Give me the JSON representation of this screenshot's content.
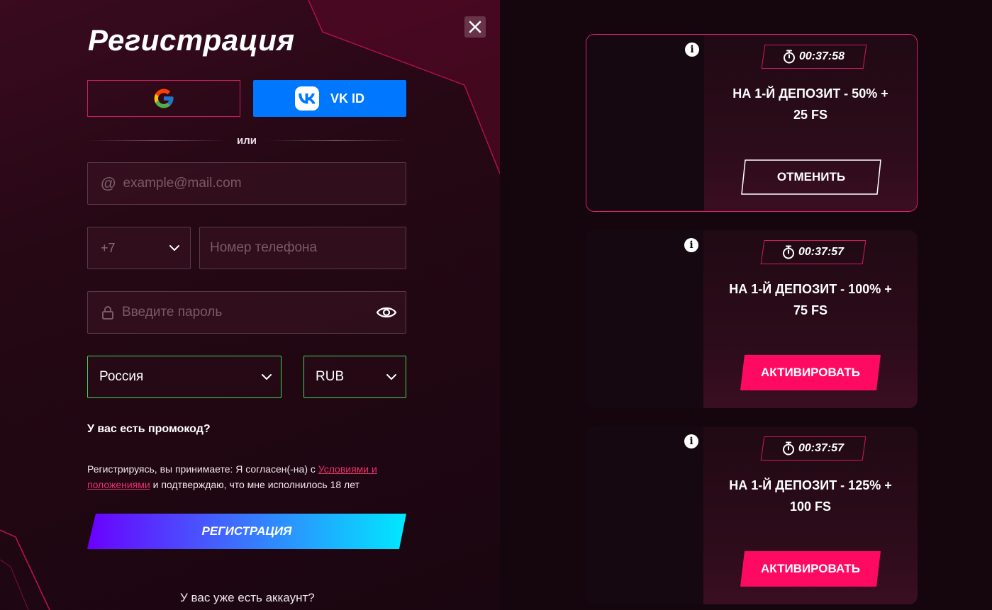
{
  "registration": {
    "title": "Регистрация",
    "vk_label": "VK ID",
    "or_text": "или",
    "email_placeholder": "example@mail.com",
    "phone_code": "+7",
    "phone_placeholder": "Номер телефона",
    "password_placeholder": "Введите пароль",
    "country": "Россия",
    "currency": "RUB",
    "promo_text": "У вас есть промокод?",
    "terms_prefix": "Регистрируясь, вы принимаете: Я согласен(-на) с ",
    "terms_link": "Условиями и положениями",
    "terms_suffix": " и подтверждаю, что мне исполнилось 18 лет",
    "register_label": "РЕГИСТРАЦИЯ",
    "has_account": "У вас уже есть аккаунт?"
  },
  "bonuses": [
    {
      "timer": "00:37:58",
      "title": "НА 1-Й ДЕПОЗИТ - 50% + 25 FS",
      "button": "ОТМЕНИТЬ",
      "selected": true
    },
    {
      "timer": "00:37:57",
      "title": "НА 1-Й ДЕПОЗИТ - 100% + 75 FS",
      "button": "АКТИВИРОВАТЬ",
      "selected": false
    },
    {
      "timer": "00:37:57",
      "title": "НА 1-Й ДЕПОЗИТ - 125% + 100 FS",
      "button": "АКТИВИРОВАТЬ",
      "selected": false
    }
  ],
  "icons": {
    "close": "close-icon",
    "google": "google-icon",
    "vk": "vk-icon",
    "at": "at-icon",
    "chevron": "chevron-down-icon",
    "lock": "lock-icon",
    "eye": "eye-icon",
    "info": "info-icon",
    "timer": "stopwatch-icon"
  },
  "colors": {
    "accent": "#ff0a63",
    "border_accent": "#d11b5c",
    "select_border": "#3fd25b",
    "vk_blue": "#0077ff"
  }
}
